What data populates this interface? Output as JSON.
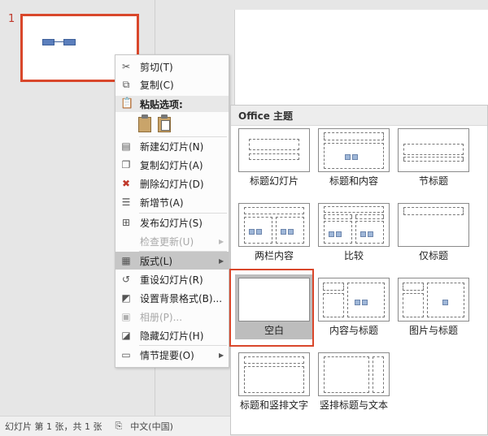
{
  "thumbnail": {
    "slide_number": "1"
  },
  "context_menu": {
    "items": [
      {
        "label": "剪切(T)",
        "icon": "scissors-icon",
        "disabled": false
      },
      {
        "label": "复制(C)",
        "icon": "copy-icon",
        "disabled": false
      },
      {
        "label": "粘贴选项:",
        "icon": "paste-icon",
        "header": true
      },
      {
        "label": "新建幻灯片(N)",
        "icon": "new-slide-icon",
        "disabled": false
      },
      {
        "label": "复制幻灯片(A)",
        "icon": "duplicate-slide-icon",
        "disabled": false
      },
      {
        "label": "删除幻灯片(D)",
        "icon": "delete-slide-icon",
        "disabled": false
      },
      {
        "label": "新增节(A)",
        "icon": "add-section-icon",
        "disabled": false
      },
      {
        "label": "发布幻灯片(S)",
        "icon": "publish-slides-icon",
        "disabled": false
      },
      {
        "label": "检查更新(U)",
        "icon": "",
        "disabled": true,
        "submenu": true
      },
      {
        "label": "版式(L)",
        "icon": "layout-icon",
        "disabled": false,
        "submenu": true,
        "highlighted": true
      },
      {
        "label": "重设幻灯片(R)",
        "icon": "reset-slide-icon",
        "disabled": false
      },
      {
        "label": "设置背景格式(B)...",
        "icon": "format-background-icon",
        "disabled": false
      },
      {
        "label": "相册(P)...",
        "icon": "photo-album-icon",
        "disabled": true
      },
      {
        "label": "隐藏幻灯片(H)",
        "icon": "hide-slide-icon",
        "disabled": false
      },
      {
        "label": "情节提要(O)",
        "icon": "storyboard-icon",
        "disabled": false,
        "submenu": true
      }
    ],
    "paste_options": [
      "keep-source-formatting",
      "picture"
    ]
  },
  "layout_menu": {
    "title": "Office 主题",
    "layouts": [
      {
        "name": "标题幻灯片"
      },
      {
        "name": "标题和内容"
      },
      {
        "name": "节标题"
      },
      {
        "name": "两栏内容"
      },
      {
        "name": "比较"
      },
      {
        "name": "仅标题"
      },
      {
        "name": "空白",
        "selected": true
      },
      {
        "name": "内容与标题"
      },
      {
        "name": "图片与标题"
      },
      {
        "name": "标题和竖排文字"
      },
      {
        "name": "竖排标题与文本"
      }
    ]
  },
  "status_bar": {
    "slide_info": "幻灯片 第 1 张，共 1 张",
    "language": "中文(中国)"
  },
  "colors": {
    "accent": "#d9472b",
    "highlight": "#c6c6c6"
  }
}
